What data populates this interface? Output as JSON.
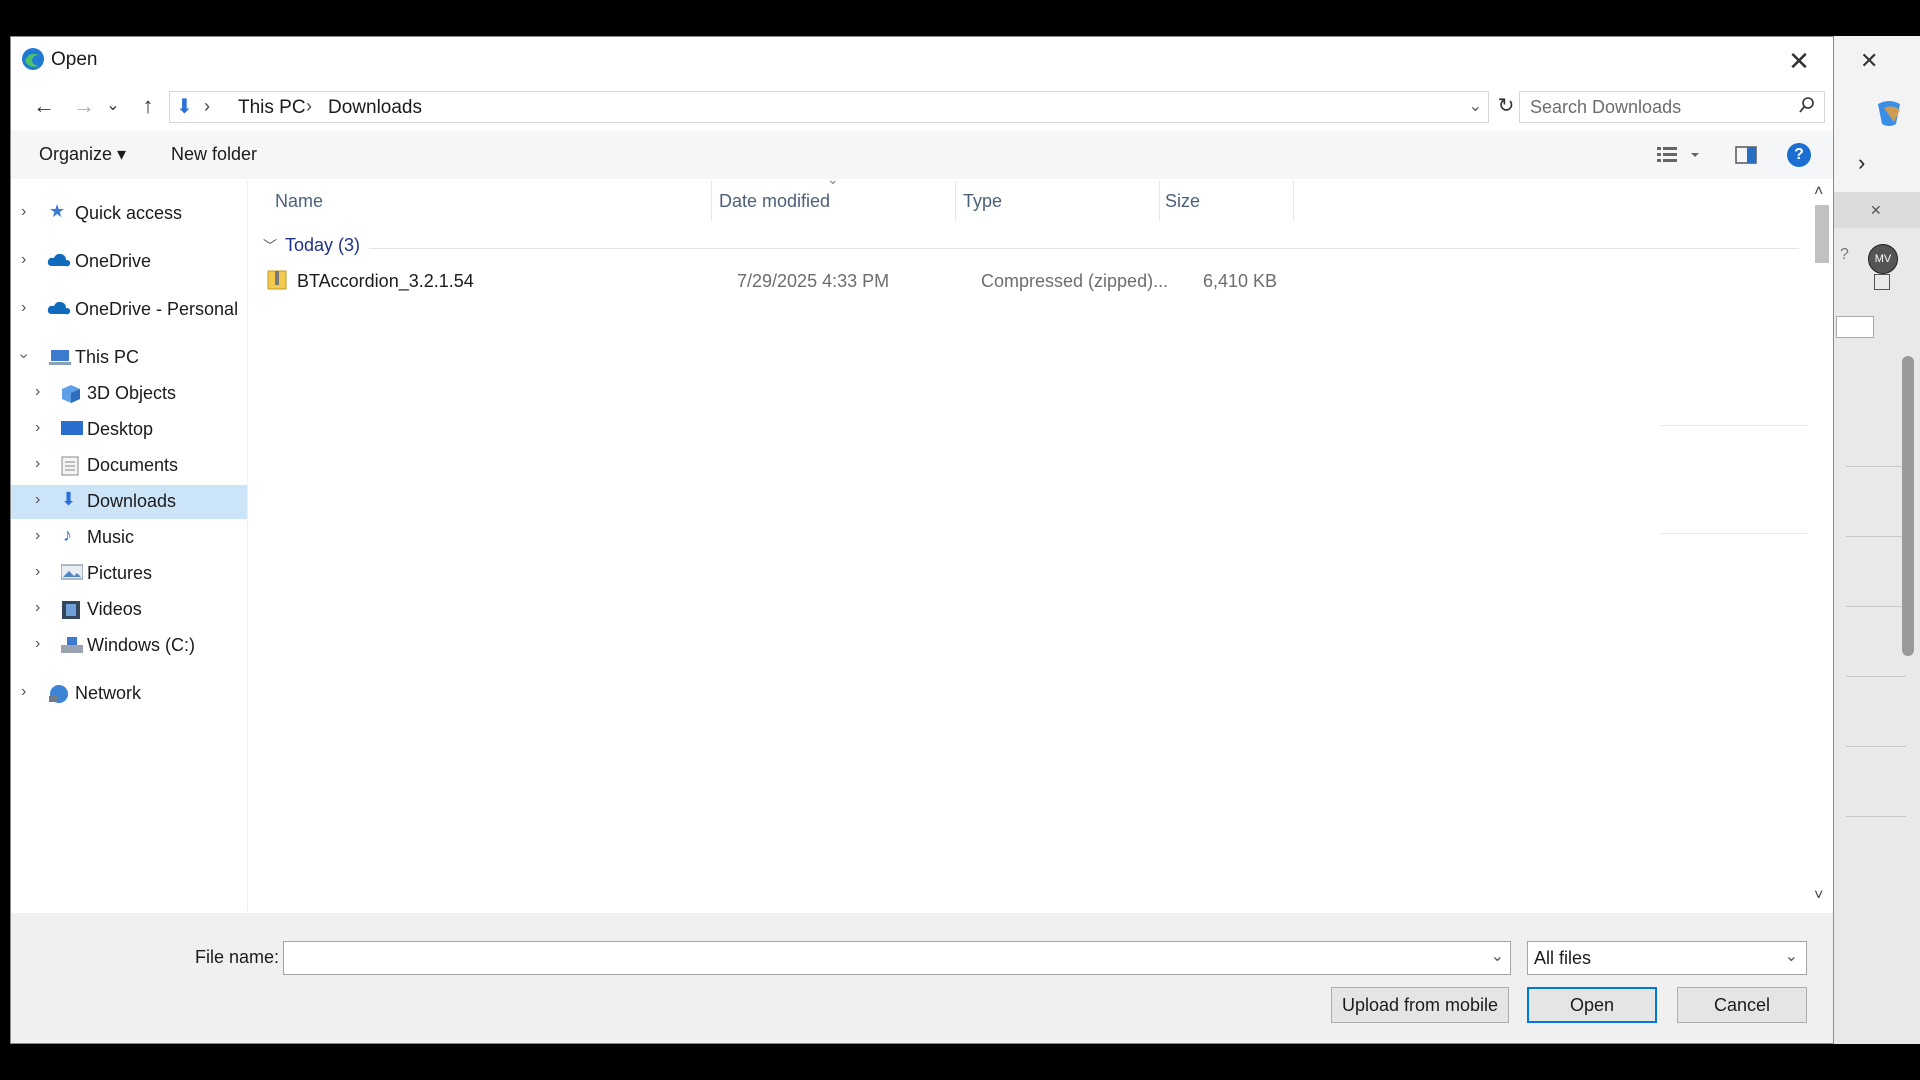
{
  "dialog": {
    "title": "Open",
    "close_glyph": "✕"
  },
  "nav": {
    "back_glyph": "←",
    "forward_glyph": "→",
    "recent_glyph": "⌄",
    "up_glyph": "↑",
    "breadcrumb": [
      "This PC",
      "Downloads"
    ],
    "refresh_glyph": "↻",
    "search_placeholder": "Search Downloads"
  },
  "toolbar": {
    "organize": "Organize ▾",
    "new_folder": "New folder"
  },
  "sidebar": {
    "items": [
      {
        "label": "Quick access",
        "icon": "star-icon"
      },
      {
        "label": "OneDrive",
        "icon": "cloud-icon"
      },
      {
        "label": "OneDrive - Personal",
        "icon": "cloud-icon"
      },
      {
        "label": "This PC",
        "icon": "computer-icon"
      },
      {
        "label": "3D Objects",
        "icon": "cube-icon"
      },
      {
        "label": "Desktop",
        "icon": "desktop-icon"
      },
      {
        "label": "Documents",
        "icon": "document-icon"
      },
      {
        "label": "Downloads",
        "icon": "download-icon"
      },
      {
        "label": "Music",
        "icon": "music-icon"
      },
      {
        "label": "Pictures",
        "icon": "pictures-icon"
      },
      {
        "label": "Videos",
        "icon": "video-icon"
      },
      {
        "label": "Windows (C:)",
        "icon": "drive-icon"
      },
      {
        "label": "Network",
        "icon": "network-icon"
      }
    ],
    "selected": "Downloads"
  },
  "list": {
    "columns": [
      "Name",
      "Date modified",
      "Type",
      "Size"
    ],
    "group_label": "Today (3)",
    "rows": [
      {
        "name": "BTAccordion_3.2.1.54",
        "date": "7/29/2025 4:33 PM",
        "type": "Compressed (zipped)...",
        "size": "6,410 KB"
      }
    ]
  },
  "bottom": {
    "file_name_label": "File name:",
    "file_name_value": "",
    "filter": "All files",
    "upload_button": "Upload from mobile",
    "open_button": "Open",
    "cancel_button": "Cancel"
  },
  "background_app": {
    "avatar": "MV"
  },
  "colors": {
    "accent": "#0078d7",
    "selected": "#cce4f7",
    "onedrive": "#0f6cbd"
  }
}
